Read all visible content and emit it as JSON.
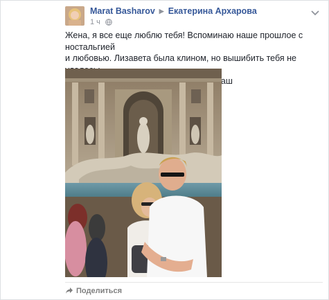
{
  "post": {
    "author": "Marat Basharov",
    "separator_icon": "right-triangle-icon",
    "recipient": "Екатерина Архарова",
    "timestamp": "1 ч",
    "privacy_icon": "globe-icon",
    "menu_icon": "chevron-down-icon",
    "text_line1": "Жена, я все еще люблю тебя! Вспоминаю наше прошлое с ностальгией",
    "text_line2": "и любовью. Лизавета была клином, но вышибить тебя не удалось:-",
    "text_line3": "))))))))) Ты моя половинка. Твой МараБаш",
    "share_icon": "share-arrow-icon",
    "share_label": "Поделиться"
  },
  "colors": {
    "link": "#365899",
    "meta": "#90949c",
    "text": "#1d2129",
    "action": "#7f7f7f"
  }
}
